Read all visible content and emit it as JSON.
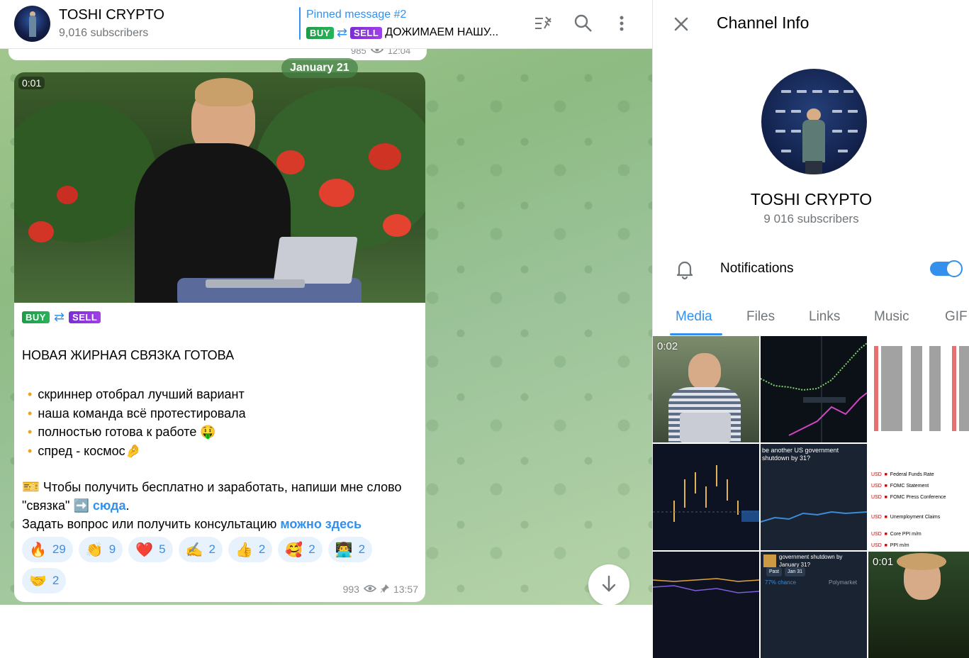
{
  "header": {
    "title": "TOSHI CRYPTO",
    "subscribers": "9,016 subscribers",
    "pinned_title": "Pinned message #2",
    "pinned_buy": "BUY",
    "pinned_sell": "SELL",
    "pinned_text": "ДОЖИМАЕМ НАШУ..."
  },
  "prev_message": {
    "views": "985",
    "time": "12:04"
  },
  "date_separator": "January 21",
  "message": {
    "video_duration": "0:01",
    "buy_badge": "BUY",
    "sell_badge": "SELL",
    "headline": "НОВАЯ ЖИРНАЯ СВЯЗКА ГОТОВА",
    "bullets": [
      "скриннер отобрал лучший вариант",
      "наша команда всё протестировала",
      "полностью готова к работе 🤑",
      "спред - космос🤌"
    ],
    "cta_prefix": "Чтобы получить бесплатно и заработать, напиши мне слово \"связка\"",
    "cta_arrow": "➡️",
    "cta_link": "сюда",
    "cta_dot": ".",
    "question_prefix": "Задать вопрос или получить консультацию",
    "question_link": "можно здесь",
    "reactions": [
      {
        "emoji": "🔥",
        "count": "29"
      },
      {
        "emoji": "👏",
        "count": "9"
      },
      {
        "emoji": "❤️",
        "count": "5"
      },
      {
        "emoji": "✍️",
        "count": "2"
      },
      {
        "emoji": "👍",
        "count": "2"
      },
      {
        "emoji": "🥰",
        "count": "2"
      },
      {
        "emoji": "👨‍💻",
        "count": "2"
      },
      {
        "emoji": "🤝",
        "count": "2"
      }
    ],
    "views": "993",
    "time": "13:57"
  },
  "panel": {
    "title": "Channel Info",
    "name": "TOSHI CRYPTO",
    "subscribers": "9 016 subscribers",
    "notifications_label": "Notifications",
    "notifications_on": true,
    "tabs": [
      "Media",
      "Files",
      "Links",
      "Music",
      "GIF"
    ],
    "active_tab": "Media",
    "media": {
      "video1_duration": "0:02",
      "video2_duration": "0:01",
      "poll1_question": "be another US government shutdown by 31?",
      "poll2_question": "government shutdown by January 31?",
      "poll2_chance": "77% chance",
      "poll2_brand": "Polymarket",
      "poll2_past": "Past",
      "poll2_date": "Jan 31",
      "calendar_rows": [
        {
          "cur": "USD",
          "event": "Federal Funds Rate"
        },
        {
          "cur": "USD",
          "event": "FOMC Statement"
        },
        {
          "cur": "USD",
          "event": "FOMC Press Conference"
        },
        {
          "cur": "USD",
          "event": "Unemployment Claims"
        },
        {
          "cur": "USD",
          "event": "Core PPI m/m"
        },
        {
          "cur": "USD",
          "event": "PPI m/m"
        }
      ]
    }
  },
  "colors": {
    "accent": "#3390ec",
    "buy": "#28b45a",
    "sell": "#a040e8"
  }
}
